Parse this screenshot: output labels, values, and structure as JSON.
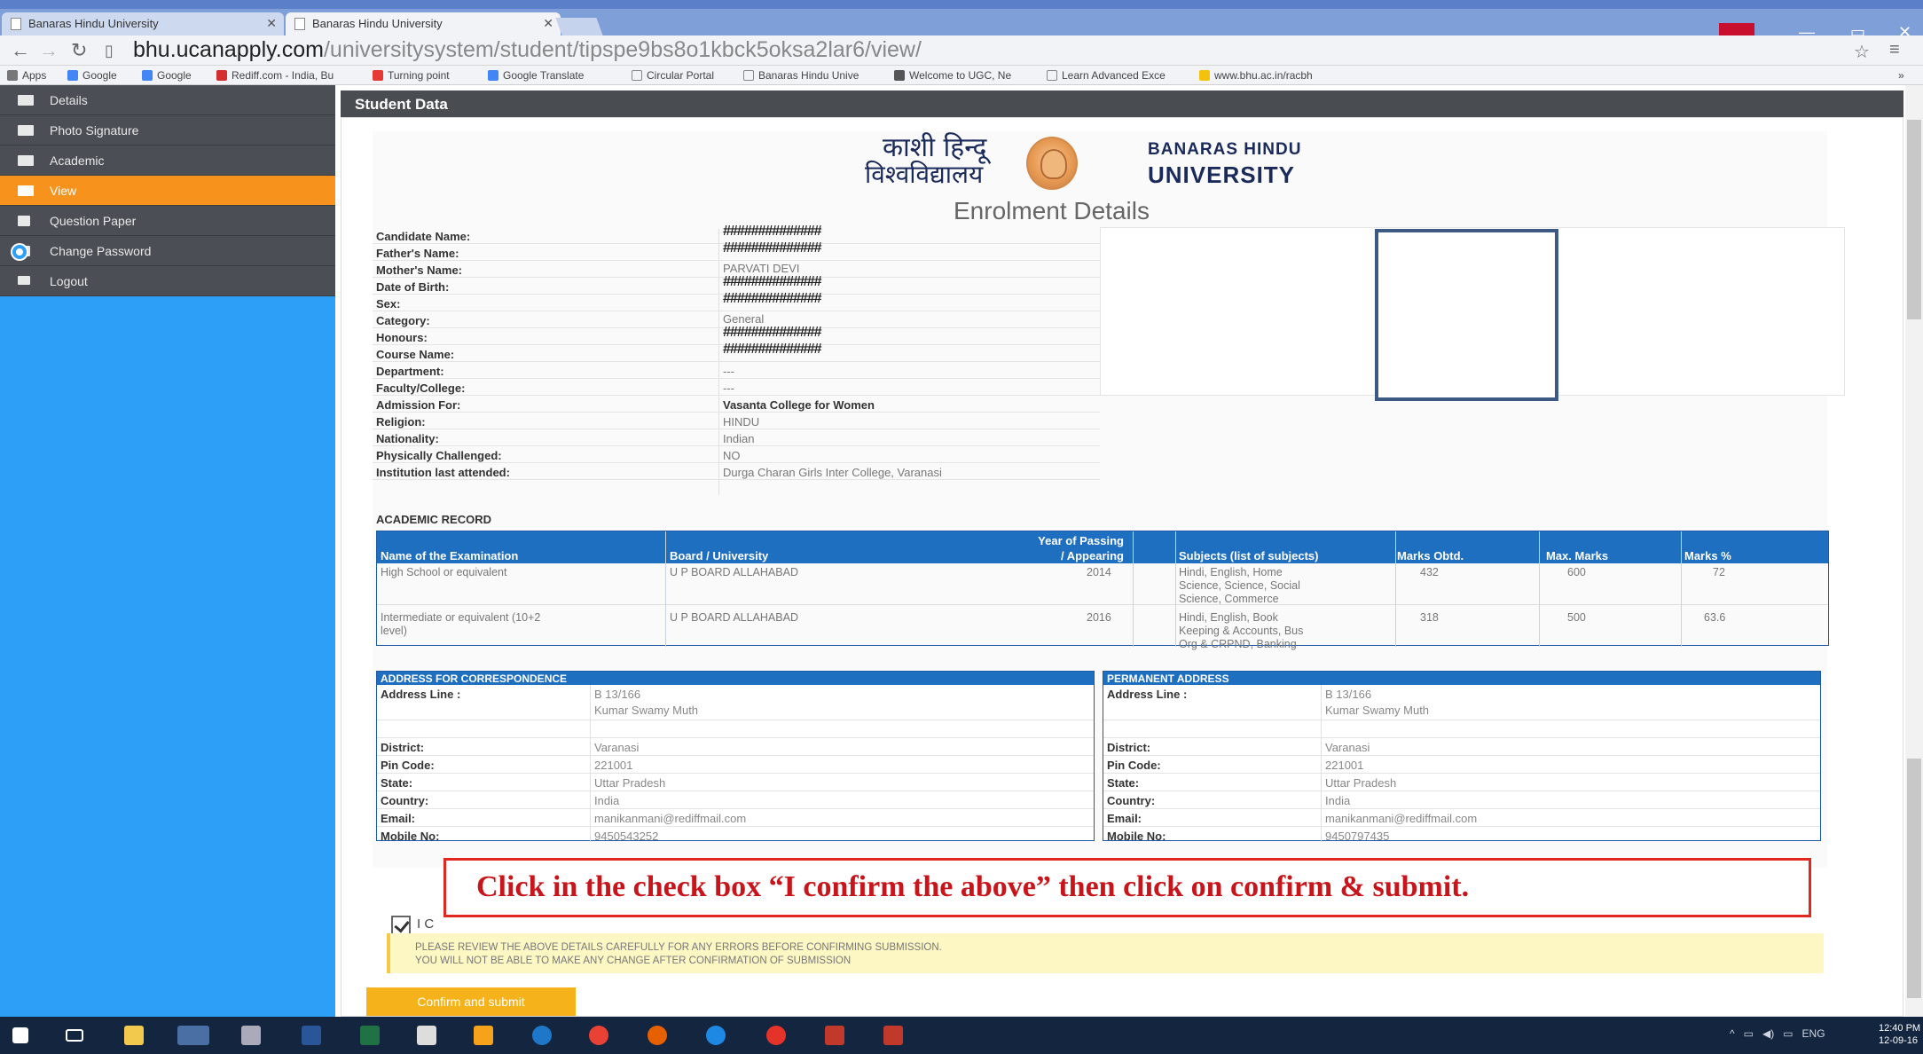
{
  "browser": {
    "tabs": [
      {
        "label": "Banaras Hindu University"
      },
      {
        "label": "Banaras Hindu University"
      }
    ],
    "url_host": "bhu.ucanapply.com",
    "url_path": "/universitysystem/student/tipspe9bs8o1kbck5oksa2lar6/view/",
    "bookmarks": [
      "Apps",
      "Google",
      "Google",
      "Rediff.com - India, Bu",
      "Turning point",
      "Google Translate",
      "Circular Portal",
      "Banaras Hindu Unive",
      "Welcome to UGC, Ne",
      "Learn Advanced Exce",
      "www.bhu.ac.in/racbh"
    ]
  },
  "sidebar": {
    "items": [
      {
        "label": "Details"
      },
      {
        "label": "Photo Signature"
      },
      {
        "label": "Academic"
      },
      {
        "label": "View"
      },
      {
        "label": "Question Paper"
      },
      {
        "label": "Change Password"
      },
      {
        "label": "Logout"
      }
    ]
  },
  "panel": {
    "title": "Student Data"
  },
  "logo": {
    "hindi_l1": "काशी हिन्दू",
    "hindi_l2": "विश्वविद्यालय",
    "en_l1": "BANARAS HINDU",
    "en_l2": "UNIVERSITY"
  },
  "enrolment": {
    "title": "Enrolment Details",
    "rows": [
      {
        "label": "Candidate Name:",
        "value": "##############"
      },
      {
        "label": "Father's Name:",
        "value": "##############"
      },
      {
        "label": "Mother's Name:",
        "value": "PARVATI DEVI"
      },
      {
        "label": "Date of Birth:",
        "value": "##############"
      },
      {
        "label": "Sex:",
        "value": "##############"
      },
      {
        "label": "Category:",
        "value": "General"
      },
      {
        "label": "Honours:",
        "value": "##############"
      },
      {
        "label": "Course Name:",
        "value": "##############"
      },
      {
        "label": "Department:",
        "value": "---"
      },
      {
        "label": "Faculty/College:",
        "value": "---"
      },
      {
        "label": "Admission For:",
        "value": "Vasanta College for Women"
      },
      {
        "label": "Religion:",
        "value": "HINDU"
      },
      {
        "label": "Nationality:",
        "value": "Indian"
      },
      {
        "label": "Physically Challenged:",
        "value": "NO"
      },
      {
        "label": "Institution last attended:",
        "value": "Durga Charan Girls Inter College, Varanasi"
      }
    ]
  },
  "academic": {
    "title": "ACADEMIC RECORD",
    "headers": [
      "Name of the Examination",
      "Board / University",
      "Year of Passing / Appearing",
      "Subjects (list of subjects)",
      "Marks Obtd.",
      "Max. Marks",
      "Marks %"
    ],
    "header_year_l1": "Year of Passing",
    "header_year_l2": "/ Appearing",
    "rows": [
      {
        "exam": "High School or equivalent",
        "board": "U P BOARD ALLAHABAD",
        "year": "2014",
        "subjects_l1": "Hindi, English, Home",
        "subjects_l2": "Science, Science, Social",
        "subjects_l3": "Science, Commerce",
        "obtd": "432",
        "max": "600",
        "pct": "72"
      },
      {
        "exam_l1": "Intermediate or equivalent (10+2",
        "exam_l2": "level)",
        "board": "U P BOARD ALLAHABAD",
        "year": "2016",
        "subjects_l1": "Hindi, English, Book",
        "subjects_l2": "Keeping & Accounts, Bus",
        "subjects_l3": "Org & CRPND, Banking",
        "obtd": "318",
        "max": "500",
        "pct": "63.6"
      }
    ]
  },
  "address_corr": {
    "title": "ADDRESS FOR CORRESPONDENCE",
    "line_label": "Address Line :",
    "line1": "B 13/166",
    "line2": "Kumar Swamy Muth",
    "district_label": "District:",
    "district": "Varanasi",
    "pin_label": "Pin Code:",
    "pin": "221001",
    "state_label": "State:",
    "state": "Uttar Pradesh",
    "country_label": "Country:",
    "country": "India",
    "email_label": "Email:",
    "email": "manikanmani@rediffmail.com",
    "mobile_label": "Mobile No:",
    "mobile": "9450543252"
  },
  "address_perm": {
    "title": "PERMANENT ADDRESS",
    "line_label": "Address Line :",
    "line1": "B 13/166",
    "line2": "Kumar Swamy Muth",
    "district_label": "District:",
    "district": "Varanasi",
    "pin_label": "Pin Code:",
    "pin": "221001",
    "state_label": "State:",
    "state": "Uttar Pradesh",
    "country_label": "Country:",
    "country": "India",
    "email_label": "Email:",
    "email": "manikanmani@rediffmail.com",
    "mobile_label": "Mobile No:",
    "mobile": "9450797435"
  },
  "annotation": "Click in the check box “I confirm the above” then click on confirm & submit.",
  "confirm_box_label": "I C",
  "warning": {
    "l1": "PLEASE REVIEW THE ABOVE DETAILS CAREFULLY FOR ANY ERRORS BEFORE CONFIRMING SUBMISSION.",
    "l2": "YOU WILL NOT BE ABLE TO MAKE ANY CHANGE AFTER CONFIRMATION OF SUBMISSION"
  },
  "confirm_button": "Confirm and submit",
  "taskbar": {
    "lang": "ENG",
    "time": "12:40 PM",
    "date": "12-09-16"
  },
  "colors": {
    "sidebar_bg": "#2e9ff6",
    "sidebar_item": "#4b4f55",
    "active": "#f7931d",
    "table_head": "#1e6fc0",
    "annotation_red": "#e0281e"
  }
}
